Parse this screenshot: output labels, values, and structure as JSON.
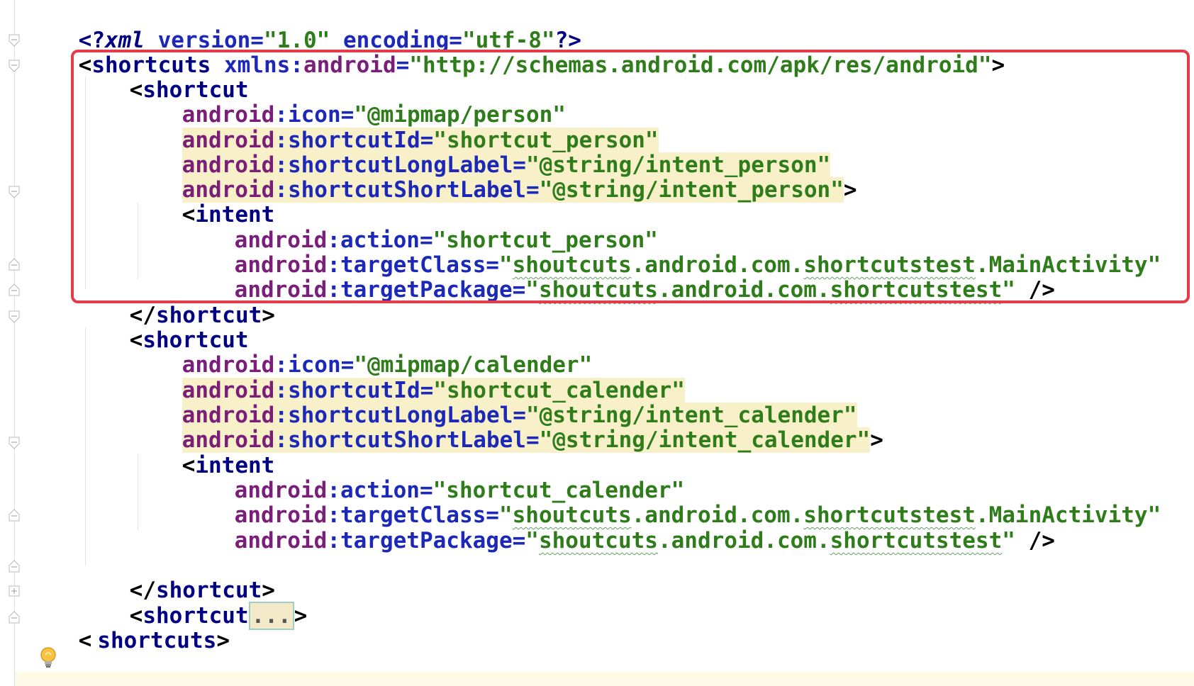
{
  "editor": {
    "lines": {
      "l1": {
        "open": "<?",
        "xml": "xml",
        "version_attr": " version=",
        "version_val": "\"1.0\"",
        "encoding_attr": " encoding=",
        "encoding_val": "\"utf-8\"",
        "close": "?>"
      },
      "l2": {
        "open": "<",
        "tag": "shortcuts",
        "ns": " xmlns:",
        "ns_name": "android",
        "eq": "=",
        "ns_val": "\"http://schemas.android.com/apk/res/android\"",
        "close": ">"
      },
      "l3": {
        "open": "<",
        "tag": "shortcut"
      },
      "l4": {
        "prefix": "android",
        "colon": ":",
        "name": "icon",
        "eq": "=",
        "val": "\"@mipmap/person\""
      },
      "l5": {
        "prefix": "android",
        "colon": ":",
        "name": "shortcutId",
        "eq": "=",
        "val": "\"shortcut_person\""
      },
      "l6": {
        "prefix": "android",
        "colon": ":",
        "name": "shortcutLongLabel",
        "eq": "=",
        "val": "\"@string/intent_person\""
      },
      "l7": {
        "prefix": "android",
        "colon": ":",
        "name": "shortcutShortLabel",
        "eq": "=",
        "val": "\"@string/intent_person\"",
        "close": ">"
      },
      "l8": {
        "open": "<",
        "tag": "intent"
      },
      "l9": {
        "prefix": "android",
        "colon": ":",
        "name": "action",
        "eq": "=",
        "val": "\"shortcut_person\""
      },
      "l10": {
        "prefix": "android",
        "colon": ":",
        "name": "targetClass",
        "eq": "=",
        "q": "\"",
        "v1": "shoutcuts",
        "dot1": ".",
        "v2": "android",
        "dot2": ".",
        "v3": "com",
        "dot3": ".",
        "v4": "shortcutstest",
        "dot4": ".",
        "v5": "MainActivity",
        "q2": "\""
      },
      "l11": {
        "prefix": "android",
        "colon": ":",
        "name": "targetPackage",
        "eq": "=",
        "q": "\"",
        "v1": "shoutcuts",
        "dot1": ".",
        "v2": "android",
        "dot2": ".",
        "v3": "com",
        "dot3": ".",
        "v4": "shortcutstest",
        "q2": "\"",
        "close": " />"
      },
      "l12": {
        "open": "</",
        "tag": "shortcut",
        "close": ">"
      },
      "l13": {
        "open": "<",
        "tag": "shortcut"
      },
      "l14": {
        "prefix": "android",
        "colon": ":",
        "name": "icon",
        "eq": "=",
        "val": "\"@mipmap/calender\""
      },
      "l15": {
        "prefix": "android",
        "colon": ":",
        "name": "shortcutId",
        "eq": "=",
        "val": "\"shortcut_calender\""
      },
      "l16": {
        "prefix": "android",
        "colon": ":",
        "name": "shortcutLongLabel",
        "eq": "=",
        "val": "\"@string/intent_calender\""
      },
      "l17": {
        "prefix": "android",
        "colon": ":",
        "name": "shortcutShortLabel",
        "eq": "=",
        "val": "\"@string/intent_calender\"",
        "close": ">"
      },
      "l18": {
        "open": "<",
        "tag": "intent"
      },
      "l19": {
        "prefix": "android",
        "colon": ":",
        "name": "action",
        "eq": "=",
        "val": "\"shortcut_calender\""
      },
      "l20": {
        "prefix": "android",
        "colon": ":",
        "name": "targetClass",
        "eq": "=",
        "q": "\"",
        "v1": "shoutcuts",
        "dot1": ".",
        "v2": "android",
        "dot2": ".",
        "v3": "com",
        "dot3": ".",
        "v4": "shortcutstest",
        "dot4": ".",
        "v5": "MainActivity",
        "q2": "\""
      },
      "l21": {
        "prefix": "android",
        "colon": ":",
        "name": "targetPackage",
        "eq": "=",
        "q": "\"",
        "v1": "shoutcuts",
        "dot1": ".",
        "v2": "android",
        "dot2": ".",
        "v3": "com",
        "dot3": ".",
        "v4": "shortcutstest",
        "q2": "\"",
        "close": " />"
      },
      "l23": {
        "open": "</",
        "tag": "shortcut",
        "close": ">"
      },
      "l24": {
        "open": "<",
        "tag": "shortcut",
        "folded": "...",
        "close": ">"
      },
      "l25": {
        "open": "<",
        "tag": "shortcuts",
        "close": ">"
      }
    },
    "colors": {
      "tag": "#000080",
      "attr": "#7a1e7a",
      "value": "#2e7d1a",
      "highlight": "#f7f0c8",
      "box": "#e23b4a"
    },
    "icons": {
      "fold": "fold-marker-icon",
      "bulb": "lightbulb-icon"
    }
  }
}
